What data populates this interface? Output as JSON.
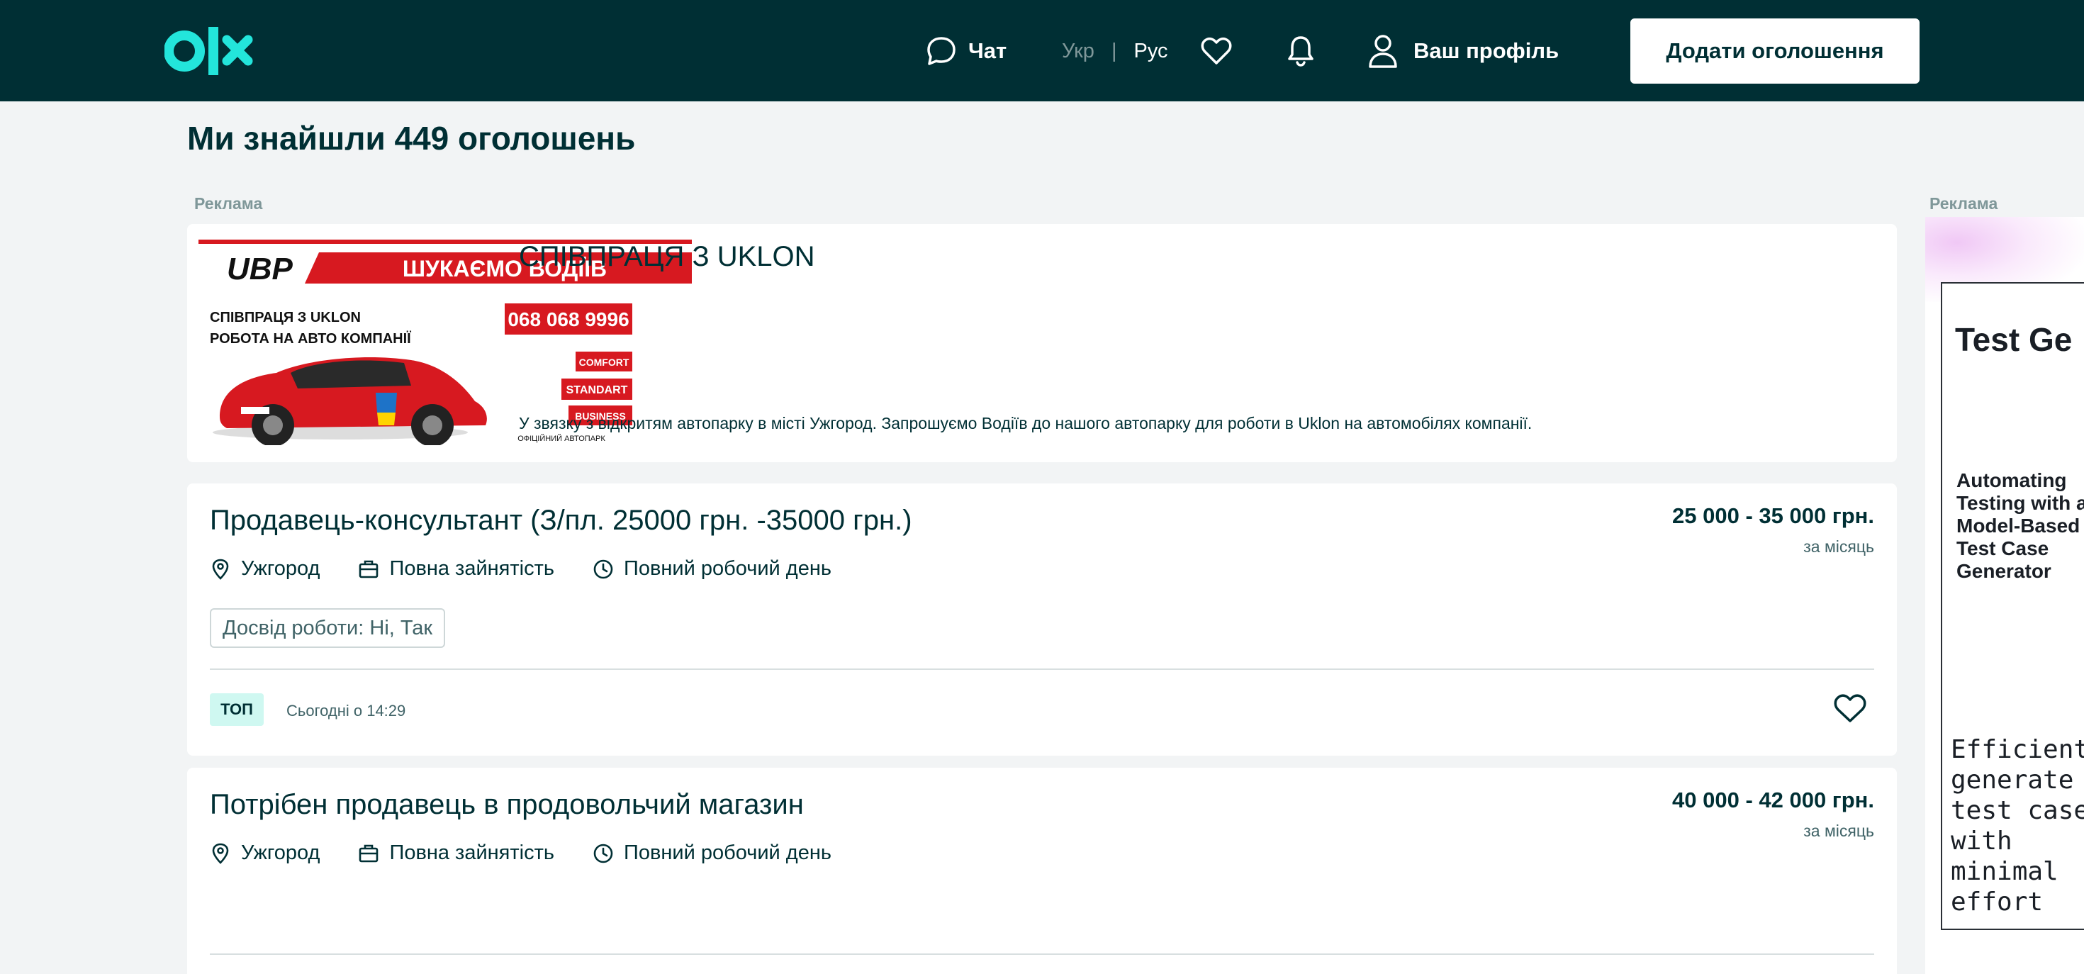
{
  "header": {
    "logo_text": "olx",
    "chat_label": "Чат",
    "lang_ukr": "Укр",
    "lang_sep": "|",
    "lang_rus": "Рус",
    "profile_label": "Ваш профіль",
    "add_button_label": "Додати оголошення"
  },
  "page_title": "Ми знайшли 449 оголошень",
  "ad_label_main": "Реклама",
  "ad_label_side": "Реклама",
  "ad_card": {
    "title": "СПІВПРАЦЯ З UKLON",
    "description": "У звязку з відкритям автопарку в місті Ужгород. Запрошуємо Водіїв до нашого автопарку для роботи в Uklon на автомобілях компанії.",
    "image": {
      "brand": "UBP",
      "headline": "ШУКАЄМО ВОДІЇВ",
      "line1": "СПІВПРАЦЯ З UKLON",
      "line2": "РОБОТА НА АВТО КОМПАНІЇ",
      "phone": "068 068 9996",
      "class1": "COMFORT",
      "class2": "STANDART",
      "class3": "BUSINESS",
      "footer": "ОФІЦІЙНИЙ АВТОПАРК"
    }
  },
  "jobs": [
    {
      "title": "Продавець-консультант (З/пл. 25000 грн. -35000 грн.)",
      "salary": "25 000 - 35 000 грн.",
      "period": "за місяць",
      "city": "Ужгород",
      "employment": "Повна зайнятість",
      "schedule": "Повний робочий день",
      "tag": "Досвід роботи: Ні, Так",
      "badge": "ТОП",
      "date": "Сьогодні о 14:29"
    },
    {
      "title": "Потрібен продавець в продовольчий магазин",
      "salary": "40 000 - 42 000 грн.",
      "period": "за місяць",
      "city": "Ужгород",
      "employment": "Повна зайнятість",
      "schedule": "Повний робочий день"
    }
  ],
  "side_ad": {
    "title": "Test Ge",
    "subtitle": "Automating Testing with a Model-Based Test Case Generator",
    "text": "Efficiently generate test cases with minimal effort"
  },
  "colors": {
    "header_bg": "#002f34",
    "accent": "#23e5db",
    "page_bg": "#f2f4f5",
    "top_badge_bg": "#cff8f1"
  }
}
